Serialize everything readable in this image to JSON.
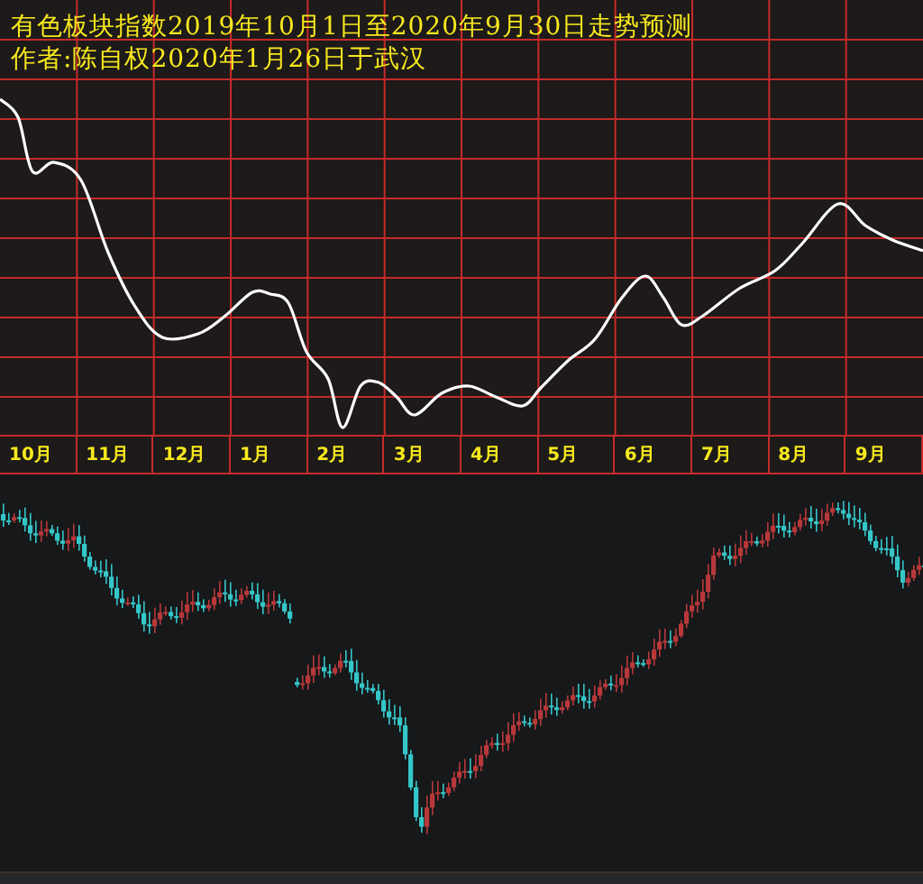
{
  "forecast_panel": {
    "title_lines": [
      "有色板块指数2019年10月1日至2020年9月30日走势预测",
      "作者:陈自权2020年1月26日于武汉"
    ],
    "months": [
      "10月",
      "11月",
      "12月",
      "1月",
      "2月",
      "3月",
      "4月",
      "5月",
      "6月",
      "7月",
      "8月",
      "9月"
    ]
  }
}
